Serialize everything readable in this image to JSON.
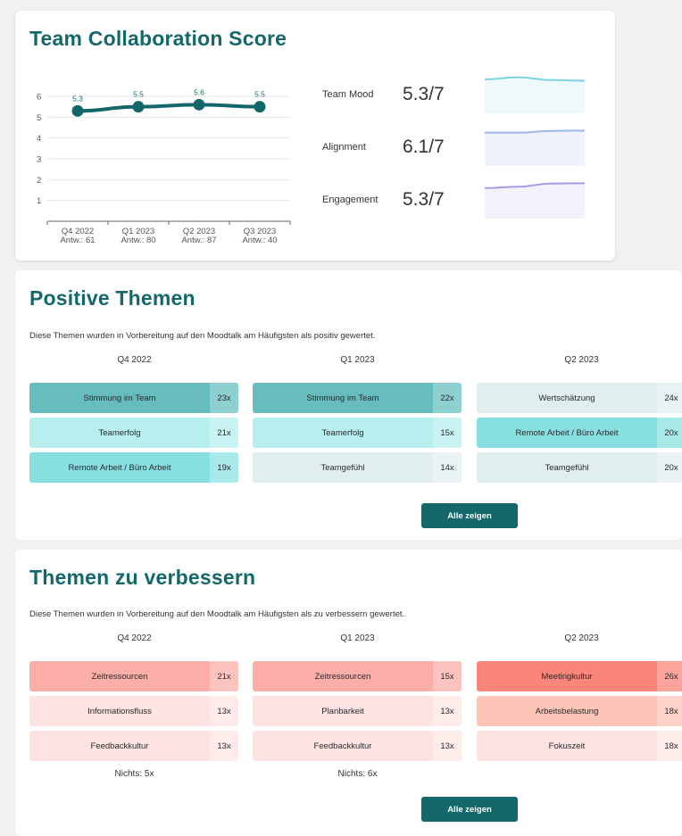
{
  "score": {
    "title": "Team Collaboration Score",
    "chart_data": {
      "type": "line",
      "categories": [
        "Q4 2022",
        "Q1 2023",
        "Q2 2023",
        "Q3 2023"
      ],
      "sublabels": [
        "Antw.: 61",
        "Antw.: 80",
        "Antw.: 87",
        "Antw.: 40"
      ],
      "values": [
        5.3,
        5.5,
        5.6,
        5.5
      ],
      "data_labels": [
        "5.3",
        "5.5",
        "5.6",
        "5.5"
      ],
      "ylim": [
        0,
        6
      ],
      "yticks": [
        "1",
        "2",
        "3",
        "4",
        "5",
        "6"
      ],
      "grid": true,
      "color": "#13676a"
    },
    "metrics": [
      {
        "label": "Team Mood",
        "value": "5.3/7",
        "color": "#7dd3df",
        "fill": "#eef9fb",
        "trend": [
          0.52,
          0.58,
          0.5,
          0.48
        ]
      },
      {
        "label": "Alignment",
        "value": "6.1/7",
        "color": "#9fb6e8",
        "fill": "#eef2fb",
        "trend": [
          0.5,
          0.5,
          0.55,
          0.56
        ]
      },
      {
        "label": "Engagement",
        "value": "5.3/7",
        "color": "#a89ae8",
        "fill": "#f2f1fc",
        "trend": [
          0.42,
          0.46,
          0.55,
          0.56
        ]
      }
    ]
  },
  "positive": {
    "title": "Positive Themen",
    "description": "Diese Themen wurden in Vorbereitung auf den Moodtalk am Häufigsten als positiv gewertet.",
    "columns": [
      {
        "quarter": "Q4 2022",
        "items": [
          {
            "label": "Stimmung im Team",
            "count": "23x",
            "bg": "#67bdbd",
            "cnt_bg": "#8ed0d0"
          },
          {
            "label": "Teamerfolg",
            "count": "21x",
            "bg": "#b7eeee",
            "cnt_bg": "#c9f3f3"
          },
          {
            "label": "Remote Arbeit / Büro Arbeit",
            "count": "19x",
            "bg": "#88dfe0",
            "cnt_bg": "#a7e8e8"
          }
        ]
      },
      {
        "quarter": "Q1 2023",
        "items": [
          {
            "label": "Stimmung im Team",
            "count": "22x",
            "bg": "#67bdbd",
            "cnt_bg": "#8ed0d0"
          },
          {
            "label": "Teamerfolg",
            "count": "15x",
            "bg": "#b7eeee",
            "cnt_bg": "#c9f3f3"
          },
          {
            "label": "Teamgefühl",
            "count": "14x",
            "bg": "#e1eeee",
            "cnt_bg": "#e9f3f3"
          }
        ]
      },
      {
        "quarter": "Q2 2023",
        "items": [
          {
            "label": "Wertschätzung",
            "count": "24x",
            "bg": "#e1eeee",
            "cnt_bg": "#e9f3f3"
          },
          {
            "label": "Remote Arbeit / Büro Arbeit",
            "count": "20x",
            "bg": "#88dfe0",
            "cnt_bg": "#a7e8e8"
          },
          {
            "label": "Teamgefühl",
            "count": "20x",
            "bg": "#e1eeee",
            "cnt_bg": "#e9f3f3"
          }
        ]
      }
    ],
    "button": "Alle zeigen"
  },
  "negative": {
    "title": "Themen zu verbessern",
    "description": "Diese Themen wurden in Vorbereitung auf den Moodtalk am Häufigsten als zu verbessern gewertet.",
    "columns": [
      {
        "quarter": "Q4 2022",
        "nothing": "Nichts: 5x",
        "items": [
          {
            "label": "Zeitressourcen",
            "count": "21x",
            "bg": "#fcaea8",
            "cnt_bg": "#fdc4bf"
          },
          {
            "label": "Informationsfluss",
            "count": "13x",
            "bg": "#fde4e2",
            "cnt_bg": "#feeceb"
          },
          {
            "label": "Feedbackkultur",
            "count": "13x",
            "bg": "#fde4e2",
            "cnt_bg": "#feeceb"
          }
        ]
      },
      {
        "quarter": "Q1 2023",
        "nothing": "Nichts: 6x",
        "items": [
          {
            "label": "Zeitressourcen",
            "count": "15x",
            "bg": "#fcaea8",
            "cnt_bg": "#fdc4bf"
          },
          {
            "label": "Planbarkeit",
            "count": "13x",
            "bg": "#fde4e2",
            "cnt_bg": "#feeceb"
          },
          {
            "label": "Feedbackkultur",
            "count": "13x",
            "bg": "#fde4e2",
            "cnt_bg": "#feeceb"
          }
        ]
      },
      {
        "quarter": "Q2 2023",
        "nothing": "",
        "items": [
          {
            "label": "Meetingkultur",
            "count": "26x",
            "bg": "#fa857b",
            "cnt_bg": "#fca39b"
          },
          {
            "label": "Arbeitsbelastung",
            "count": "18x",
            "bg": "#fdc5b8",
            "cnt_bg": "#fed4ca"
          },
          {
            "label": "Fokuszeit",
            "count": "18x",
            "bg": "#fde4e2",
            "cnt_bg": "#feeceb"
          }
        ]
      }
    ],
    "button": "Alle zeigen"
  }
}
